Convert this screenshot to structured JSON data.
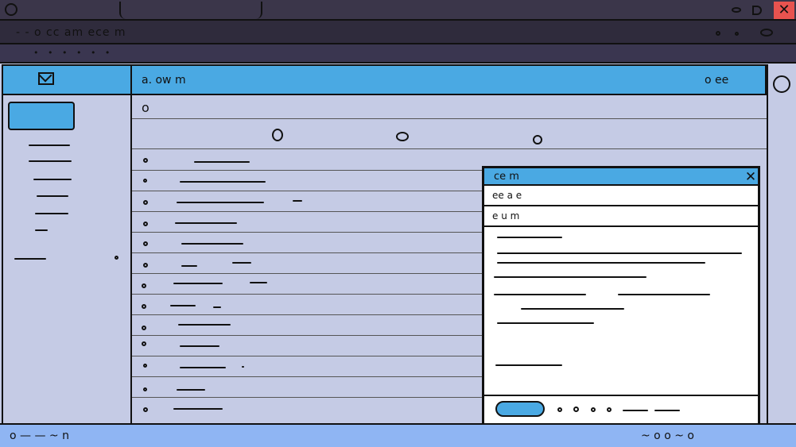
{
  "window": {
    "title": "",
    "close_glyph": "✕"
  },
  "menubar": {
    "label": "- - o  cc am  ece m"
  },
  "toolbar": {
    "label": "• • • • • •"
  },
  "header": {
    "title": "a. ow m",
    "action_label": "o ee"
  },
  "list": {
    "header_label": "o"
  },
  "popup": {
    "title": "ce m",
    "close_glyph": "✕",
    "to_field": "ee a e",
    "subject_field": "e u m"
  },
  "statusbar": {
    "label": "o  — — ~  n",
    "right_label": "~ o o ~ o"
  },
  "colors": {
    "accent": "#4aa9e3",
    "panel": "#c5cbe5",
    "status": "#8fb5f3",
    "close": "#e8534f",
    "chrome": "#3b364a"
  }
}
